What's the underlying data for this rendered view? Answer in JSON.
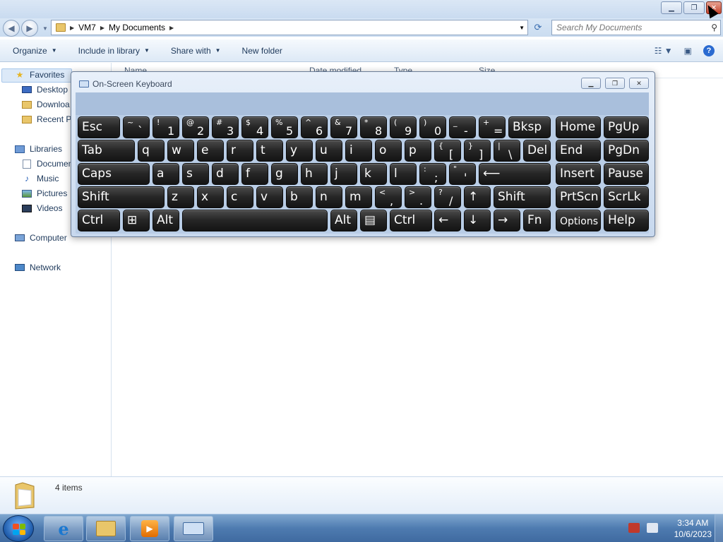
{
  "explorer": {
    "breadcrumb": [
      "VM7",
      "My Documents"
    ],
    "search_placeholder": "Search My Documents",
    "commands": [
      "Organize",
      "Include in library",
      "Share with",
      "New folder"
    ],
    "columns": [
      "Name",
      "Date modified",
      "Type",
      "Size"
    ],
    "nav": {
      "favorites": "Favorites",
      "desktop": "Desktop",
      "downloads": "Downloa",
      "recent": "Recent Pl",
      "libraries": "Libraries",
      "documents": "Documen",
      "music": "Music",
      "pictures": "Pictures",
      "videos": "Videos",
      "computer": "Computer",
      "network": "Network"
    },
    "status_count": "4 items"
  },
  "osk": {
    "title": "On-Screen Keyboard",
    "rows": [
      [
        {
          "main": "Esc",
          "w": "wide"
        },
        {
          "top": "~",
          "bottom": "`"
        },
        {
          "top": "!",
          "bottom": "1"
        },
        {
          "top": "@",
          "bottom": "2"
        },
        {
          "top": "#",
          "bottom": "3"
        },
        {
          "top": "$",
          "bottom": "4"
        },
        {
          "top": "%",
          "bottom": "5"
        },
        {
          "top": "^",
          "bottom": "6"
        },
        {
          "top": "&",
          "bottom": "7"
        },
        {
          "top": "*",
          "bottom": "8"
        },
        {
          "top": "(",
          "bottom": "9"
        },
        {
          "top": ")",
          "bottom": "0"
        },
        {
          "top": "_",
          "bottom": "-"
        },
        {
          "top": "+",
          "bottom": "="
        },
        {
          "main": "Bksp"
        },
        {
          "main": "Home"
        },
        {
          "main": "PgUp"
        }
      ],
      [
        {
          "main": "Tab"
        },
        {
          "main": "q"
        },
        {
          "main": "w"
        },
        {
          "main": "e"
        },
        {
          "main": "r"
        },
        {
          "main": "t"
        },
        {
          "main": "y"
        },
        {
          "main": "u"
        },
        {
          "main": "i"
        },
        {
          "main": "o"
        },
        {
          "main": "p"
        },
        {
          "top": "{",
          "bottom": "["
        },
        {
          "top": "}",
          "bottom": "]"
        },
        {
          "top": "|",
          "bottom": "\\"
        },
        {
          "main": "Del"
        },
        {
          "main": "End"
        },
        {
          "main": "PgDn"
        }
      ],
      [
        {
          "main": "Caps"
        },
        {
          "main": "a"
        },
        {
          "main": "s"
        },
        {
          "main": "d"
        },
        {
          "main": "f"
        },
        {
          "main": "g"
        },
        {
          "main": "h"
        },
        {
          "main": "j"
        },
        {
          "main": "k"
        },
        {
          "main": "l"
        },
        {
          "top": ":",
          "bottom": ";"
        },
        {
          "top": "\"",
          "bottom": "'"
        },
        {
          "main": "⟵"
        },
        {
          "main": "Insert"
        },
        {
          "main": "Pause"
        }
      ],
      [
        {
          "main": "Shift"
        },
        {
          "main": "z"
        },
        {
          "main": "x"
        },
        {
          "main": "c"
        },
        {
          "main": "v"
        },
        {
          "main": "b"
        },
        {
          "main": "n"
        },
        {
          "main": "m"
        },
        {
          "top": "<",
          "bottom": ","
        },
        {
          "top": ">",
          "bottom": "."
        },
        {
          "top": "?",
          "bottom": "/"
        },
        {
          "main": "↑"
        },
        {
          "main": "Shift"
        },
        {
          "main": "PrtScn"
        },
        {
          "main": "ScrLk"
        }
      ],
      [
        {
          "main": "Ctrl"
        },
        {
          "main": "⊞"
        },
        {
          "main": "Alt"
        },
        {
          "main": ""
        },
        {
          "main": "Alt"
        },
        {
          "main": "▤"
        },
        {
          "main": "Ctrl"
        },
        {
          "main": "←"
        },
        {
          "main": "↓"
        },
        {
          "main": "→"
        },
        {
          "main": "Fn"
        },
        {
          "main": "Options",
          "small": true
        },
        {
          "main": "Help"
        }
      ]
    ]
  },
  "taskbar": {
    "time": "3:34 AM",
    "date": "10/6/2023"
  }
}
